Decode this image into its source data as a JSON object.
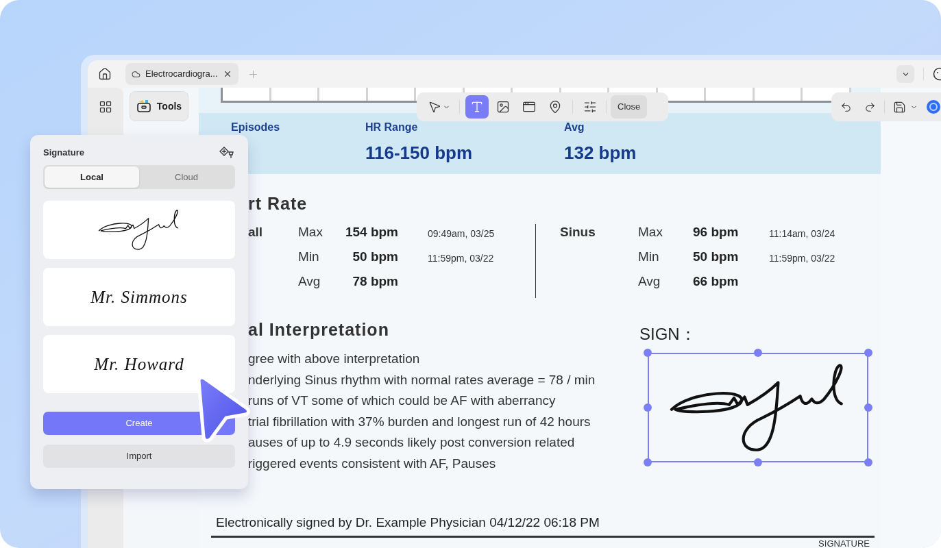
{
  "tab_bar": {
    "tab": {
      "title": "Electrocardiogra...",
      "selected": true
    }
  },
  "tools_button": "Tools",
  "toolbar": {
    "tools": [
      {
        "kind": "select",
        "selected": false
      },
      {
        "kind": "text",
        "selected": true
      },
      {
        "kind": "image",
        "selected": false
      },
      {
        "kind": "link",
        "selected": false
      },
      {
        "kind": "location",
        "selected": false
      },
      {
        "kind": "settings",
        "selected": false
      }
    ],
    "close": "Close"
  },
  "summary": [
    {
      "label": "Episodes"
    },
    {
      "label": "HR Range",
      "value": "116-150 bpm"
    },
    {
      "label": "Avg",
      "value": "132 bpm"
    }
  ],
  "heart_rate": {
    "heading": "rt Rate",
    "groups": [
      {
        "name": "all",
        "rows": [
          {
            "label": "Max",
            "value": "154 bpm",
            "time": "09:49am, 03/25"
          },
          {
            "label": "Min",
            "value": "50 bpm",
            "time": "11:59pm, 03/22"
          },
          {
            "label": "Avg",
            "value": "78 bpm"
          }
        ]
      },
      {
        "name": "Sinus",
        "rows": [
          {
            "label": "Max",
            "value": "96 bpm",
            "time": "11:14am, 03/24"
          },
          {
            "label": "Min",
            "value": "50 bpm",
            "time": "11:59pm, 03/22"
          },
          {
            "label": "Avg",
            "value": "66 bpm"
          }
        ]
      }
    ]
  },
  "interpretation": {
    "heading": "al Interpretation",
    "lines": [
      "gree with above interpretation",
      "nderlying Sinus rhythm with normal rates average = 78 / min",
      "runs of VT some of which could be AF with aberrancy",
      "trial fibrillation with 37% burden and longest run of 42 hours",
      "auses of up to 4.9 seconds likely post conversion related",
      "riggered events consistent with AF, Pauses"
    ]
  },
  "sign": {
    "label": "SIGN：",
    "selected": true
  },
  "footer": {
    "signed_by": "Electronically signed by Dr. Example Physician 04/12/22 06:18 PM",
    "caption": "SIGNATURE"
  },
  "signature_panel": {
    "title": "Signature",
    "tabs": [
      {
        "label": "Local",
        "selected": true
      },
      {
        "label": "Cloud",
        "selected": false
      }
    ],
    "signatures": [
      {
        "kind": "drawn"
      },
      {
        "kind": "written",
        "text": "Mr. Simmons"
      },
      {
        "kind": "written",
        "text": "Mr. Howard"
      }
    ],
    "buttons": [
      {
        "label": "Create",
        "kind": "primary"
      },
      {
        "label": "Import",
        "kind": "secondary"
      }
    ]
  }
}
